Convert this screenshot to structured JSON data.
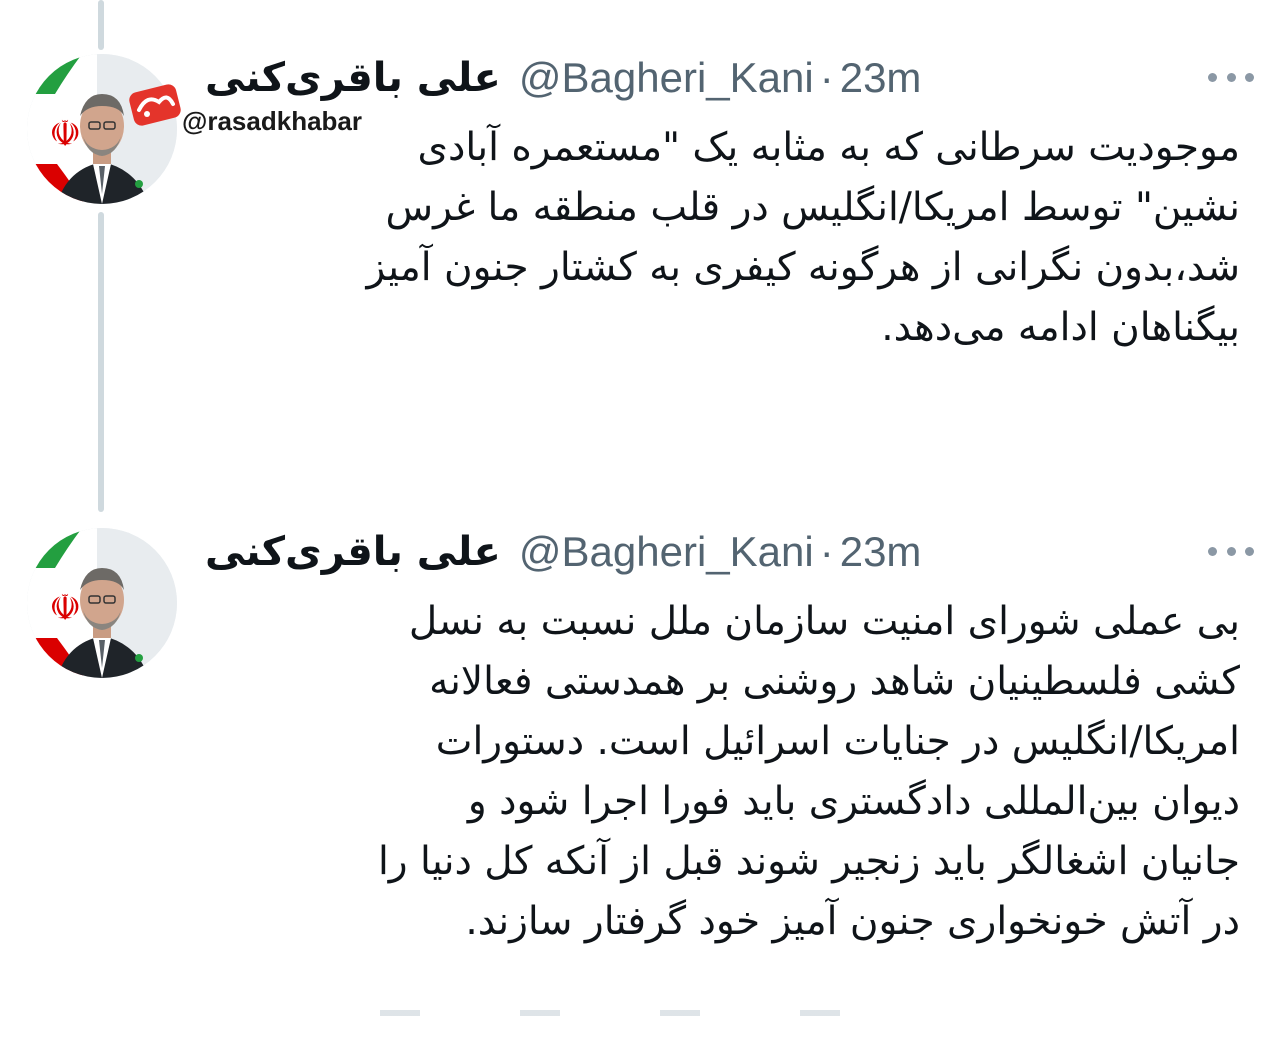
{
  "watermark": {
    "handle": "@rasadkhabar"
  },
  "tweets": [
    {
      "display_name": "علی باقری‌کنی",
      "handle": "@Bagheri_Kani",
      "separator": "·",
      "time": "23m",
      "text": "موجودیت سرطانی که به مثابه یک \"مستعمره آبادی\nنشین\" توسط امریکا/انگلیس در قلب منطقه ما غرس\nشد،بدون نگرانی از هرگونه کیفری به کشتار جنون آمیز\nبیگناهان ادامه می‌دهد."
    },
    {
      "display_name": "علی باقری‌کنی",
      "handle": "@Bagheri_Kani",
      "separator": "·",
      "time": "23m",
      "text": "بی عملی شورای امنیت سازمان ملل نسبت به نسل\nکشی فلسطینیان شاهد روشنی بر همدستی فعالانه\nامریکا/انگلیس در جنایات اسرائیل است. دستورات\nدیوان بین‌المللی دادگستری باید فورا اجرا شود و\nجانیان اشغالگر باید زنجیر شوند قبل از آنکه کل دنیا را\nدر آتش خونخواری جنون آمیز خود گرفتار سازند."
    }
  ],
  "colors": {
    "text": "#0f1419",
    "secondary": "#536471",
    "thread_line": "#cfd9de",
    "flag_green": "#239f40",
    "flag_red": "#da0000"
  },
  "icons": {
    "more": "more-horizontal-icon",
    "flag": "iran-flag",
    "watermark_logo": "rasad-logo"
  }
}
